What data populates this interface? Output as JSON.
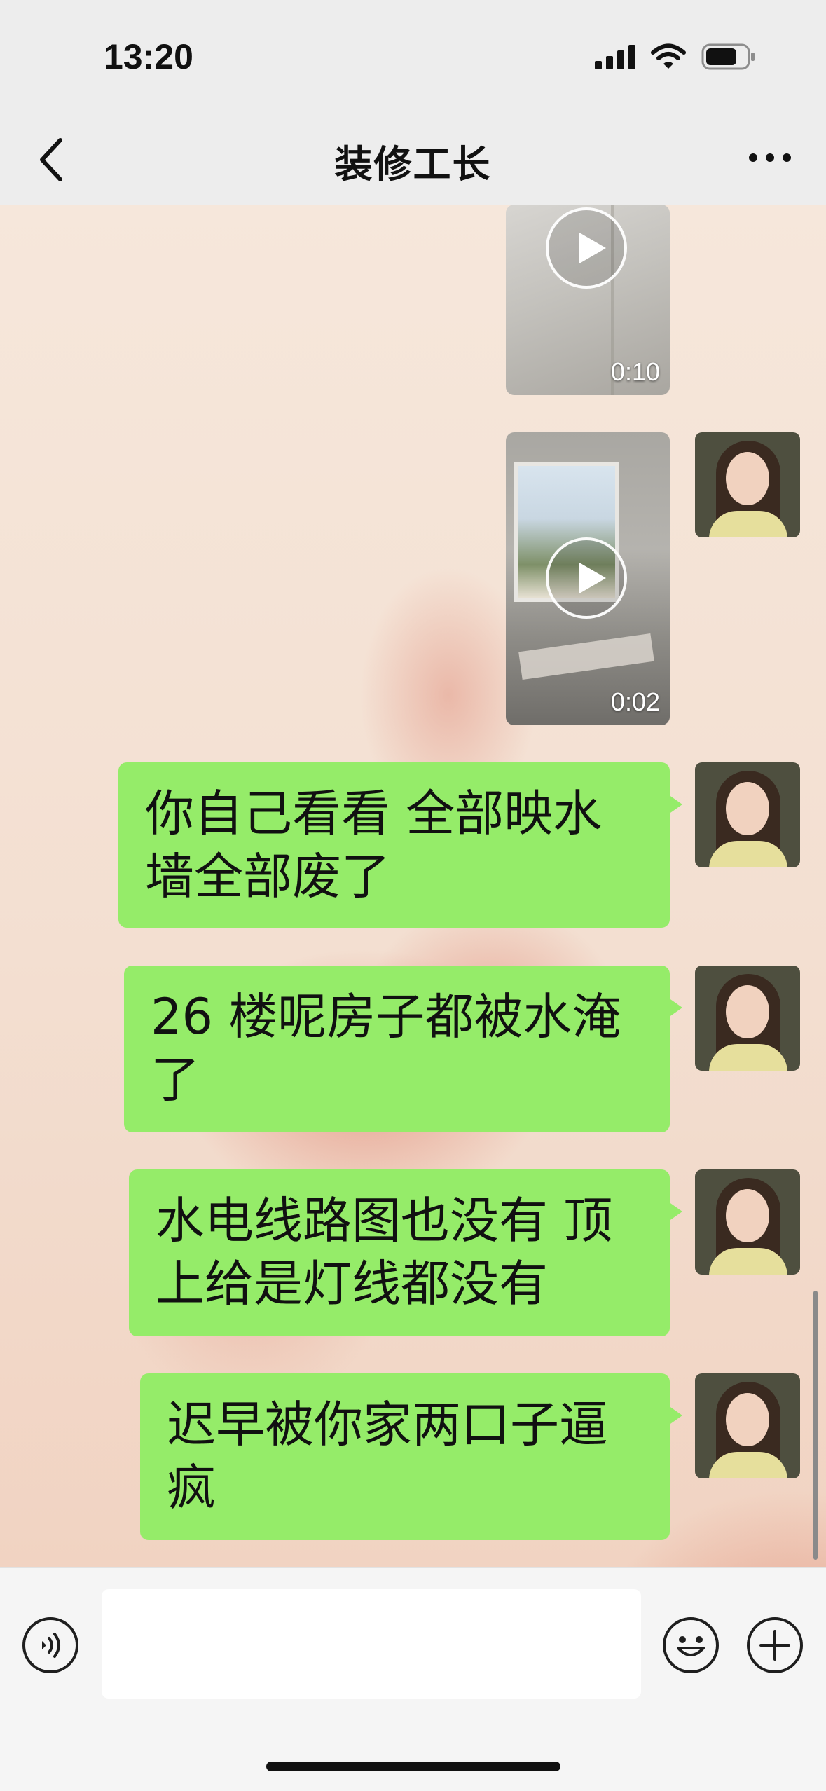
{
  "status_bar": {
    "time": "13:20",
    "icons": [
      "signal-icon",
      "wifi-icon",
      "battery-icon"
    ]
  },
  "nav": {
    "title": "装修工长",
    "back_icon": "chevron-left-icon",
    "more_icon": "more-dots-icon"
  },
  "messages": [
    {
      "type": "video",
      "sender": "me",
      "duration": "0:10"
    },
    {
      "type": "video",
      "sender": "me",
      "duration": "0:02"
    },
    {
      "type": "text",
      "sender": "me",
      "lines": [
        "你自己看看 全部映水",
        "墙全部废了"
      ]
    },
    {
      "type": "text",
      "sender": "me",
      "lines": [
        "26 楼呢房子都被水淹",
        "了"
      ]
    },
    {
      "type": "text",
      "sender": "me",
      "lines": [
        "水电线路图也没有 顶",
        "上给是灯线都没有"
      ]
    },
    {
      "type": "text",
      "sender": "me",
      "lines": [
        "迟早被你家两口子逼",
        "疯"
      ]
    }
  ],
  "input_bar": {
    "placeholder": "",
    "icons": [
      "voice-icon",
      "emoji-icon",
      "plus-icon"
    ]
  },
  "colors": {
    "bubble": "#95ec69",
    "bar_bg": "#ededed",
    "input_bg": "#f5f5f5"
  }
}
